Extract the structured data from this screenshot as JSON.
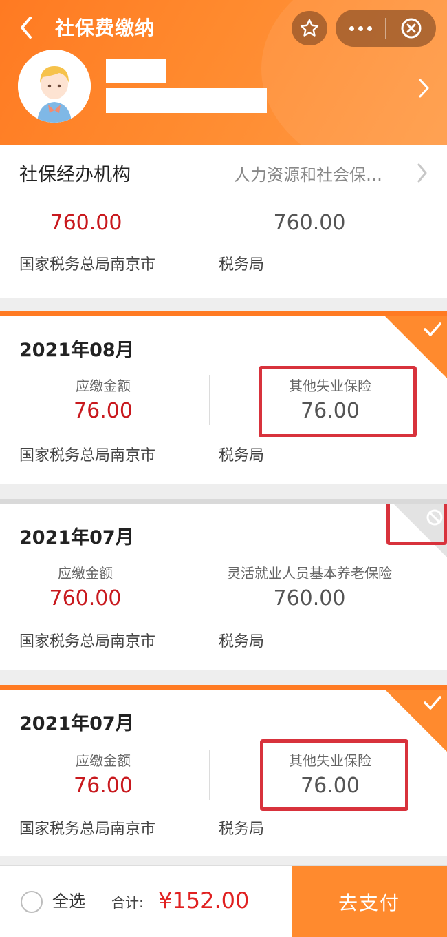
{
  "header": {
    "back_icon": "chevron-left-icon",
    "title": "社保费缴纳",
    "star_icon": "star-icon",
    "more_icon": "more-icon",
    "close_icon": "close-circle-icon",
    "avatar_icon": "user-avatar-icon",
    "chevron_icon": "chevron-right-icon",
    "accent_color": "#ff7a22"
  },
  "agency": {
    "label": "社保经办机构",
    "value": "人力资源和社会保…"
  },
  "top_card": {
    "amount": "760.00",
    "insurance_amount": "760.00",
    "office_left": "国家税务总局南京市",
    "office_right": "税务局"
  },
  "records": [
    {
      "date": "2021年08月",
      "amount_label": "应缴金额",
      "amount": "76.00",
      "insurance_type": "其他失业保险",
      "insurance_amount": "76.00",
      "office_left": "国家税务总局南京市",
      "office_right": "税务局",
      "state": "selected"
    },
    {
      "date": "2021年07月",
      "amount_label": "应缴金额",
      "amount": "760.00",
      "insurance_type": "灵活就业人员基本养老保险",
      "insurance_amount": "760.00",
      "office_left": "国家税务总局南京市",
      "office_right": "税务局",
      "state": "disabled"
    },
    {
      "date": "2021年07月",
      "amount_label": "应缴金额",
      "amount": "76.00",
      "insurance_type": "其他失业保险",
      "insurance_amount": "76.00",
      "office_left": "国家税务总局南京市",
      "office_right": "税务局",
      "state": "selected"
    }
  ],
  "footer": {
    "select_all": "全选",
    "total_label": "合计:",
    "total_value": "¥152.00",
    "pay_button": "去支付"
  }
}
